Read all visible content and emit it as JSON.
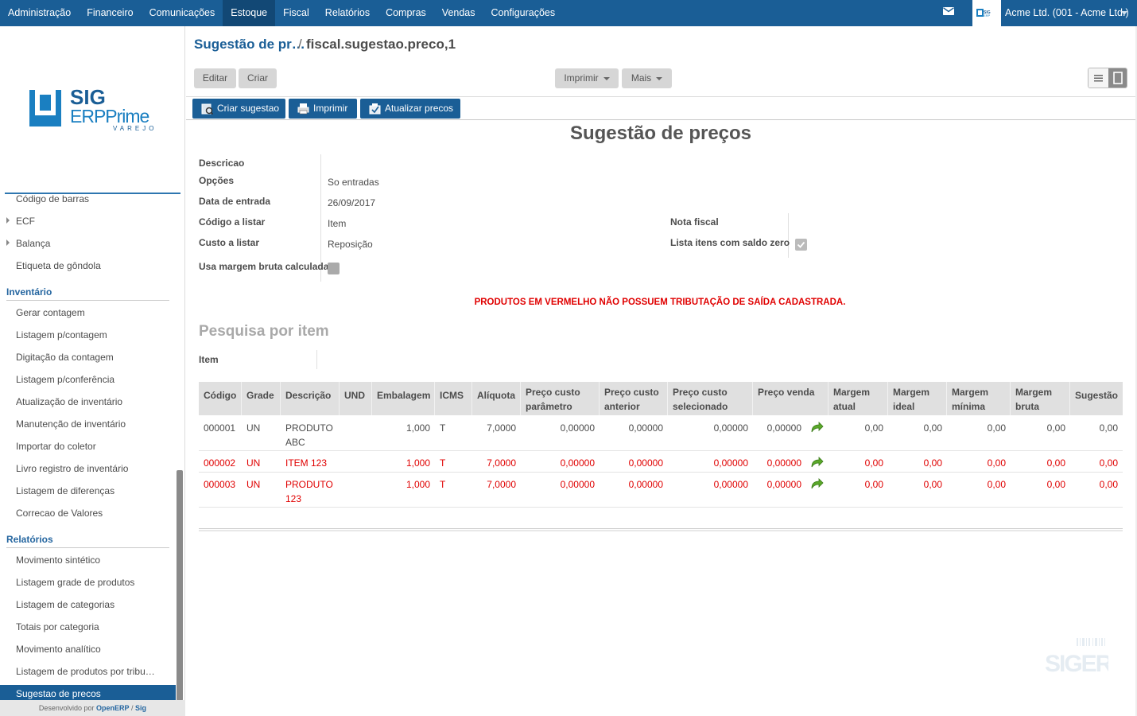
{
  "topnav": {
    "menu": [
      "Administração",
      "Financeiro",
      "Comunicações",
      "Estoque",
      "Fiscal",
      "Relatórios",
      "Compras",
      "Vendas",
      "Configurações"
    ],
    "active": "Estoque",
    "company": "Acme Ltd. (001 - Acme Ltd.)"
  },
  "sidebar": {
    "logo": "SIG ERP Prime VAREJO",
    "items_top": [
      {
        "label": "Código de barras",
        "caret": false
      },
      {
        "label": "ECF",
        "caret": true
      },
      {
        "label": "Balança",
        "caret": true
      },
      {
        "label": "Etiqueta de gôndola",
        "caret": false
      }
    ],
    "section_inventario": "Inventário",
    "items_inventario": [
      "Gerar contagem",
      "Listagem p/contagem",
      "Digitação da contagem",
      "Listagem p/conferência",
      "Atualização de inventário",
      "Manutenção de inventário",
      "Importar do coletor",
      "Livro registro de inventário",
      "Listagem de diferenças",
      "Correcao de Valores"
    ],
    "section_relatorios": "Relatórios",
    "items_relatorios": [
      "Movimento sintético",
      "Listagem grade de produtos",
      "Listagem de categorias",
      "Totais por categoria",
      "Movimento analítico",
      "Listagem de produtos por tribu…"
    ],
    "selected": "Sugestao de precos",
    "footer_prefix": "Desenvolvido por",
    "footer_link1": "OpenERP",
    "footer_sep": "/",
    "footer_link2": "Sig"
  },
  "breadcrumb": {
    "parent": "Sugestão de pr…",
    "separator": "/",
    "current": "fiscal.sugestao.preco,1"
  },
  "toolbar": {
    "edit": "Editar",
    "create": "Criar",
    "print": "Imprimir",
    "more": "Mais"
  },
  "actions": {
    "create_suggestion": "Criar sugestao",
    "print": "Imprimir",
    "update_prices": "Atualizar precos"
  },
  "form": {
    "title": "Sugestão de preços",
    "fields": {
      "descricao_label": "Descricao",
      "descricao_value": "",
      "opcoes_label": "Opções",
      "opcoes_value": "So entradas",
      "data_label": "Data de entrada",
      "data_value": "26/09/2017",
      "codigo_label": "Código a listar",
      "codigo_value": "Item",
      "custo_label": "Custo a listar",
      "custo_value": "Reposição",
      "margem_label": "Usa margem bruta calculada",
      "nota_label": "Nota fiscal",
      "nota_value": "",
      "lista_label": "Lista itens com saldo zero"
    },
    "warning": "PRODUTOS EM VERMELHO NÃO POSSUEM TRIBUTAÇÃO DE SAÍDA CADASTRADA.",
    "search_title": "Pesquisa por item",
    "item_label": "Item"
  },
  "grid": {
    "columns": [
      "Código",
      "Grade",
      "Descrição",
      "UND",
      "Embalagem",
      "ICMS",
      "Alíquota",
      "Preço custo parâmetro",
      "Preço custo anterior",
      "Preço custo selecionado",
      "Preço venda",
      "Margem atual",
      "Margem ideal",
      "Margem mínima",
      "Margem bruta",
      "Sugestão"
    ],
    "rows": [
      {
        "codigo": "000001",
        "grade": "UN",
        "descricao": "PRODUTO ABC",
        "und": "",
        "embalagem": "1,000",
        "icms": "T",
        "aliquota": "7,0000",
        "pc_param": "0,00000",
        "pc_ant": "0,00000",
        "pc_sel": "0,00000",
        "pvenda": "0,00000",
        "m_atual": "0,00",
        "m_ideal": "0,00",
        "m_min": "0,00",
        "m_bruta": "0,00",
        "sugestao": "0,00",
        "red": false
      },
      {
        "codigo": "000002",
        "grade": "UN",
        "descricao": "ITEM 123",
        "und": "",
        "embalagem": "1,000",
        "icms": "T",
        "aliquota": "7,0000",
        "pc_param": "0,00000",
        "pc_ant": "0,00000",
        "pc_sel": "0,00000",
        "pvenda": "0,00000",
        "m_atual": "0,00",
        "m_ideal": "0,00",
        "m_min": "0,00",
        "m_bruta": "0,00",
        "sugestao": "0,00",
        "red": true
      },
      {
        "codigo": "000003",
        "grade": "UN",
        "descricao": "PRODUTO 123",
        "und": "",
        "embalagem": "1,000",
        "icms": "T",
        "aliquota": "7,0000",
        "pc_param": "0,00000",
        "pc_ant": "0,00000",
        "pc_sel": "0,00000",
        "pvenda": "0,00000",
        "m_atual": "0,00",
        "m_ideal": "0,00",
        "m_min": "0,00",
        "m_bruta": "0,00",
        "sugestao": "0,00",
        "red": true
      }
    ]
  },
  "colors": {
    "brand": "#1a5e96",
    "danger": "#e00000",
    "go_icon": "#5aa829"
  },
  "icons": [
    "mail-icon",
    "caret-down-icon",
    "list-view-icon",
    "form-view-icon",
    "create-icon",
    "print-icon",
    "update-icon",
    "go-arrow-icon"
  ]
}
